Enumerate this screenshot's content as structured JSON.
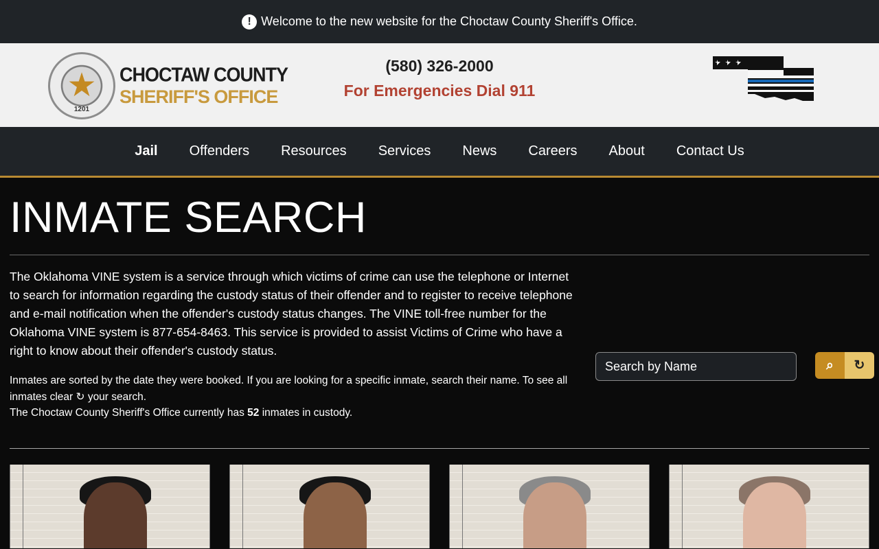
{
  "alert": {
    "text": "Welcome to the new website for the Choctaw County Sheriff's Office.",
    "icon": "alert-circle-icon"
  },
  "header": {
    "logo": {
      "top": "CHOCTAW COUNTY",
      "bottom": "SHERIFF'S OFFICE",
      "badge_text": "1201"
    },
    "phone": "(580) 326-2000",
    "emergency": "For Emergencies Dial 911",
    "flag_icon": "oklahoma-thin-blue-line-flag-icon"
  },
  "nav": [
    "Jail",
    "Offenders",
    "Resources",
    "Services",
    "News",
    "Careers",
    "About",
    "Contact Us"
  ],
  "page": {
    "title": "INMATE SEARCH",
    "intro": "The Oklahoma VINE system is a service through which victims of crime can use the telephone or Internet to search for information regarding the custody status of their offender and to register to receive telephone and e-mail notification when the offender's custody status changes. The VINE toll-free number for the Oklahoma VINE system is 877-654-8463. This service is provided to assist Victims of Crime who have a right to know about their offender's custody status.",
    "note_prefix": "Inmates are sorted by the date they were booked. If you are looking for a specific inmate, search their name. To see all inmates clear",
    "note_suffix": "your search.",
    "count_prefix": "The Choctaw County Sheriff's Office currently has",
    "count_value": "52",
    "count_suffix": "inmates in custody."
  },
  "search": {
    "placeholder": "Search by Name",
    "search_icon": "search-icon",
    "refresh_icon": "refresh-icon"
  },
  "colors": {
    "gold": "#c58c22",
    "light_gold": "#e8c56c",
    "emergency_red": "#b24232",
    "dark": "#202428"
  }
}
